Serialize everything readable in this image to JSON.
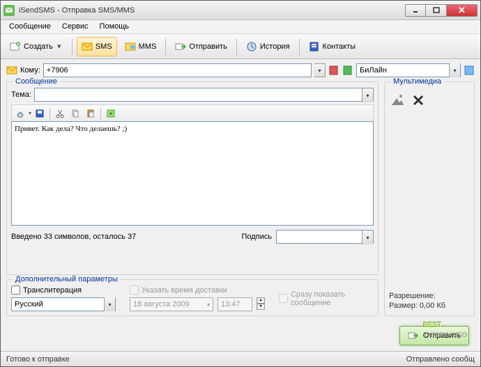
{
  "window": {
    "title": "iSendSMS - Отправка SMS/MMS"
  },
  "menu": {
    "message": "Сообщение",
    "service": "Сервис",
    "help": "Помощь"
  },
  "toolbar": {
    "create": "Создать",
    "sms": "SMS",
    "mms": "MMS",
    "send": "Отправить",
    "history": "История",
    "contacts": "Контакты"
  },
  "to": {
    "label": "Кому:",
    "value": "+7906",
    "carrier": "БиЛайн"
  },
  "message_group": {
    "legend": "Сообщение",
    "subject_label": "Тема:",
    "body": "Привет. Как дела? Что делаешь? ;)",
    "count": "Введено 33 символов, осталось 37",
    "signature_label": "Подпись"
  },
  "mm": {
    "legend": "Мультимедиа",
    "resolution_label": "Разрешение:",
    "size_label": "Размер: 0,00 Кб"
  },
  "extra": {
    "legend": "Дополнительный параметры",
    "translit": "Транслитерация",
    "delivery_time": "Указать время доставки",
    "show_now": "Сразу показать сообщение",
    "language": "Русский",
    "date": "18 августа 2009",
    "time": "13:47"
  },
  "send_button": "Отправить",
  "status": {
    "ready": "Готово к отправке",
    "sent": "Отправлено сообщ"
  },
  "watermark": {
    "main": "BEST",
    "sub": "ZHMAK.INFO"
  }
}
